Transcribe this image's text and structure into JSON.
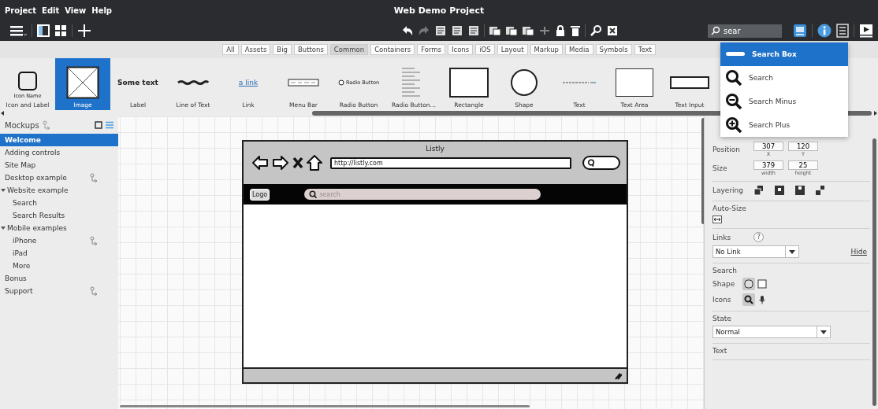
{
  "menu": [
    "Project",
    "Edit",
    "View",
    "Help"
  ],
  "window": {
    "title": "Web Demo Project"
  },
  "quick_search": {
    "value": "sear"
  },
  "search_results": [
    {
      "label": "Search Box",
      "kind": "searchbox",
      "selected": true
    },
    {
      "label": "Search",
      "kind": "search",
      "selected": false
    },
    {
      "label": "Search Minus",
      "kind": "minus",
      "selected": false
    },
    {
      "label": "Search Plus",
      "kind": "plus",
      "selected": false
    }
  ],
  "filter_tabs": [
    {
      "label": "All",
      "selected": false
    },
    {
      "label": "Assets",
      "selected": false
    },
    {
      "label": "Big",
      "selected": false
    },
    {
      "label": "Buttons",
      "selected": false
    },
    {
      "label": "Common",
      "selected": true
    },
    {
      "label": "Containers",
      "selected": false
    },
    {
      "label": "Forms",
      "selected": false
    },
    {
      "label": "Icons",
      "selected": false
    },
    {
      "label": "iOS",
      "selected": false
    },
    {
      "label": "Layout",
      "selected": false
    },
    {
      "label": "Markup",
      "selected": false
    },
    {
      "label": "Media",
      "selected": false
    },
    {
      "label": "Symbols",
      "selected": false
    },
    {
      "label": "Text",
      "selected": false
    }
  ],
  "library": [
    {
      "label": "Icon and Label",
      "kind": "icon-label",
      "caption": "Icon Name",
      "selected": false
    },
    {
      "label": "Image",
      "kind": "image",
      "selected": true
    },
    {
      "label": "Label",
      "kind": "label",
      "caption": "Some text",
      "selected": false
    },
    {
      "label": "Line of Text",
      "kind": "line",
      "selected": false
    },
    {
      "label": "Link",
      "kind": "link",
      "caption": "a link",
      "selected": false
    },
    {
      "label": "Menu Bar",
      "kind": "menubar",
      "selected": false
    },
    {
      "label": "Radio Button",
      "kind": "radio",
      "caption": "Radio Button",
      "selected": false
    },
    {
      "label": "Radio Button…",
      "kind": "radiogroup",
      "selected": false
    },
    {
      "label": "Rectangle",
      "kind": "rect",
      "selected": false
    },
    {
      "label": "Shape",
      "kind": "circle",
      "selected": false
    },
    {
      "label": "Text",
      "kind": "text",
      "selected": false
    },
    {
      "label": "Text Area",
      "kind": "textarea",
      "selected": false
    },
    {
      "label": "Text Input",
      "kind": "textinput",
      "selected": false
    }
  ],
  "sidebar": {
    "title": "Mockups",
    "items": [
      {
        "label": "Welcome",
        "selected": true,
        "linked": false
      },
      {
        "label": "Adding controls",
        "selected": false,
        "linked": false
      },
      {
        "label": "Site Map",
        "selected": false,
        "linked": false
      },
      {
        "label": "Desktop example",
        "selected": false,
        "linked": true
      },
      {
        "label": "Website example",
        "selected": false,
        "linked": false,
        "expanded": true,
        "children": [
          {
            "label": "Search",
            "selected": false,
            "linked": false
          },
          {
            "label": "Search Results",
            "selected": false,
            "linked": false
          }
        ]
      },
      {
        "label": "Mobile examples",
        "selected": false,
        "linked": false,
        "expanded": true,
        "children": [
          {
            "label": "iPhone",
            "selected": false,
            "linked": true
          },
          {
            "label": "iPad",
            "selected": false,
            "linked": false
          },
          {
            "label": "More",
            "selected": false,
            "linked": false
          }
        ]
      },
      {
        "label": "Bonus",
        "selected": false,
        "linked": false
      },
      {
        "label": "Support",
        "selected": false,
        "linked": true
      }
    ]
  },
  "mockup": {
    "title": "Listly",
    "url": "http://listly.com",
    "logo": "Logo",
    "search_placeholder": "search"
  },
  "properties": {
    "position": {
      "label": "Position",
      "fields": [
        {
          "value": "307",
          "caption": "X"
        },
        {
          "value": "120",
          "caption": "Y"
        }
      ]
    },
    "size": {
      "label": "Size",
      "fields": [
        {
          "value": "379",
          "caption": "width"
        },
        {
          "value": "25",
          "caption": "height"
        }
      ]
    },
    "layering": {
      "label": "Layering"
    },
    "auto_size": {
      "label": "Auto-Size"
    },
    "links": {
      "label": "Links",
      "help": "?",
      "value": "No Link",
      "hide": "Hide"
    },
    "search": {
      "title": "Search",
      "shape_label": "Shape",
      "shapes": [
        {
          "kind": "rounded",
          "selected": true
        },
        {
          "kind": "square",
          "selected": false
        }
      ],
      "icons_label": "Icons",
      "icons": [
        {
          "kind": "magnifier",
          "selected": true
        },
        {
          "kind": "microphone",
          "selected": false
        }
      ]
    },
    "state": {
      "label": "State",
      "value": "Normal"
    },
    "text": {
      "label": "Text"
    }
  }
}
